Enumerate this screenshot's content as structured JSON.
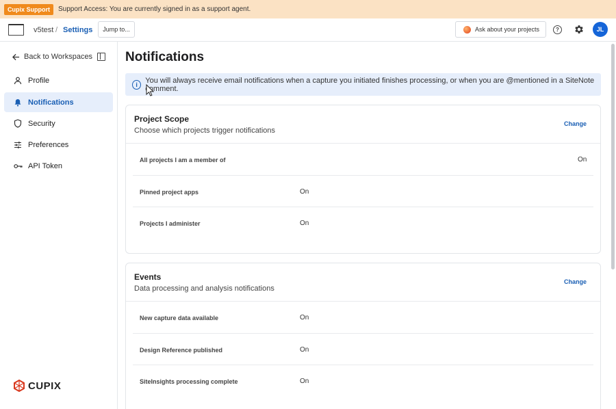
{
  "banner": {
    "badge": "Cupix Support",
    "message": "Support Access: You are currently signed in as a support agent."
  },
  "topbar": {
    "workspace": "v5test",
    "separator": "/",
    "current": "Settings",
    "jump_label": "Jump to...",
    "ask_label": "Ask about your projects",
    "help_glyph": "?",
    "avatar_initials": "JL"
  },
  "sidebar": {
    "back_label": "Back to Workspaces",
    "items": [
      {
        "label": "Profile",
        "icon": "person-icon",
        "active": false
      },
      {
        "label": "Notifications",
        "icon": "bell-icon",
        "active": true
      },
      {
        "label": "Security",
        "icon": "shield-icon",
        "active": false
      },
      {
        "label": "Preferences",
        "icon": "sliders-icon",
        "active": false
      },
      {
        "label": "API Token",
        "icon": "key-icon",
        "active": false
      }
    ],
    "brand": "CUPIX"
  },
  "main": {
    "title": "Notifications",
    "info": "You will always receive email notifications when a capture you initiated finishes processing, or when you are @mentioned in a SiteNote comment.",
    "cards": [
      {
        "title": "Project Scope",
        "subtitle": "Choose which projects trigger notifications",
        "change_label": "Change",
        "rows": [
          {
            "label": "All projects I am a member of",
            "value": "On"
          },
          {
            "label": "Pinned project apps",
            "value": "On"
          },
          {
            "label": "Projects I administer",
            "value": "On"
          }
        ]
      },
      {
        "title": "Events",
        "subtitle": "Data processing and analysis notifications",
        "change_label": "Change",
        "rows": [
          {
            "label": "New capture data available",
            "value": "On"
          },
          {
            "label": "Design Reference published",
            "value": "On"
          },
          {
            "label": "SiteInsights processing complete",
            "value": "On"
          }
        ]
      }
    ]
  },
  "colors": {
    "accent": "#1a5fb4",
    "banner_bg": "#fbe2c4",
    "badge_bg": "#f08a1c",
    "active_bg": "#e6eefb",
    "avatar_bg": "#1565d8"
  }
}
